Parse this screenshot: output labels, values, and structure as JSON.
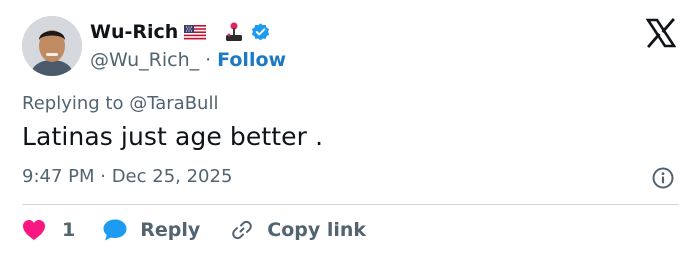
{
  "author": {
    "display_name": "Wu-Rich",
    "handle": "@Wu_Rich_",
    "separator": "·",
    "follow_label": "Follow",
    "badges": [
      "us-flag-icon",
      "joystick-icon",
      "verified-badge-icon"
    ],
    "verified_color": "#1d9bf0"
  },
  "tweet": {
    "replying_prefix": "Replying to",
    "replying_to": "@TaraBull",
    "text": "Latinas just age better .",
    "timestamp": "9:47 PM · Dec 25, 2025"
  },
  "actions": {
    "like_count": "1",
    "reply_label": "Reply",
    "copy_label": "Copy link"
  },
  "colors": {
    "like": "#f91880",
    "reply": "#1d9bf0",
    "follow": "#1d79c4",
    "muted": "#536471",
    "text": "#0f1419"
  }
}
